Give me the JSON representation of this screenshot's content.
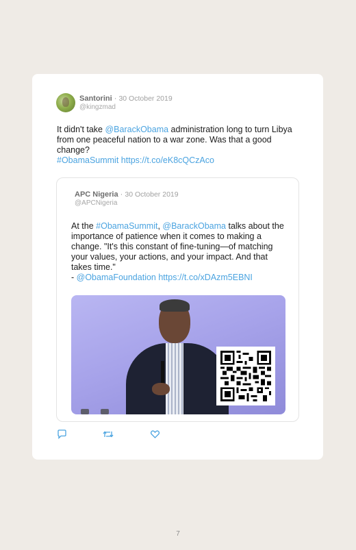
{
  "tweet": {
    "author_name": "Santorini",
    "separator": " · ",
    "date": "30 October 2019",
    "handle": "@kingzmad",
    "text_parts": {
      "p1": "It didn't take ",
      "mention1": "@BarackObama",
      "p2": " administration long to turn Libya from one peaceful nation to a war zone. Was that a good change?",
      "hashtag": "#ObamaSummit",
      "space": " ",
      "link": "https://t.co/eK8cQCzAco"
    }
  },
  "quoted_tweet": {
    "author_name": "APC Nigeria",
    "separator": " · ",
    "date": "30 October 2019",
    "handle": "@APCNigeria",
    "text_parts": {
      "p1": "At the ",
      "hashtag": "#ObamaSummit",
      "comma": ", ",
      "mention1": "@BarackObama",
      "p2": " talks about the importance of patience when it comes to making a change. \"It's this constant of fine-tuning—of matching your values, your actions, and your impact. And that takes time.\"",
      "dash": "- ",
      "mention2": "@ObamaFoundation",
      "space": " ",
      "link": "https://t.co/xDAzm5EBNI"
    }
  },
  "actions": {
    "reply_icon": "reply-icon",
    "retweet_icon": "retweet-icon",
    "like_icon": "heart-icon"
  },
  "colors": {
    "link": "#4aa3e0",
    "background": "#efebe6",
    "card": "#ffffff"
  },
  "page_number": "7"
}
